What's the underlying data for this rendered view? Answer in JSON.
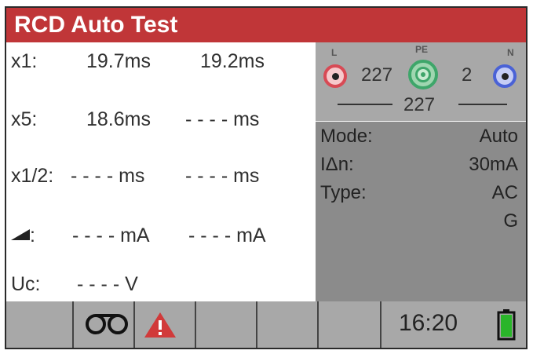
{
  "header": {
    "title": "RCD Auto Test"
  },
  "results": {
    "x1": {
      "label": "x1:",
      "v1": "19.7ms",
      "v2": "19.2ms"
    },
    "x5": {
      "label": "x5:",
      "v1": "18.6ms",
      "v2": "- - - - ms"
    },
    "xhalf": {
      "label": "x1/2:",
      "v1": "- - - - ms",
      "v2": "- - - - ms"
    },
    "ramp": {
      "label": ":",
      "v1": "- - - - mA",
      "v2": "- - - - mA"
    },
    "uc": {
      "label": "Uc:",
      "v1": "- - - - V"
    }
  },
  "connections": {
    "terminal_l": "L",
    "terminal_pe": "PE",
    "terminal_n": "N",
    "l_pe_voltage": "227",
    "pe_n_voltage": "2",
    "l_n_voltage": "227",
    "colors": {
      "l": "#d84a55",
      "pe": "#3ea66a",
      "n": "#4a62d6"
    }
  },
  "settings": {
    "mode_label": "Mode:",
    "mode_value": "Auto",
    "idn_label": "IΔn:",
    "idn_value": "30mA",
    "type_label": "Type:",
    "type_value": "AC",
    "type_value2": "G"
  },
  "status": {
    "time": "16:20",
    "icons": [
      "tape-icon",
      "warning-icon",
      "battery-icon"
    ],
    "battery_level": 1.0,
    "colors": {
      "header": "#c03638",
      "warning": "#d13a3a",
      "battery": "#2ab52a"
    }
  }
}
